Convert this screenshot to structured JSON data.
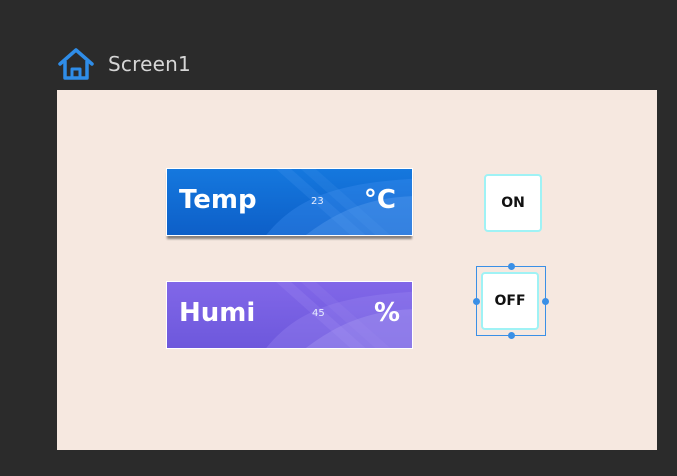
{
  "header": {
    "screen_name": "Screen1",
    "icon": "home-icon"
  },
  "colors": {
    "background": "#2b2b2b",
    "canvas": "#f6e8e0",
    "temp_widget": "#1570d8",
    "humi_widget": "#7962e4",
    "button_border": "#9ff2f5",
    "selection": "#3a8fe6"
  },
  "widgets": {
    "temp": {
      "label": "Temp",
      "value": "23",
      "unit": "°C"
    },
    "humi": {
      "label": "Humi",
      "value": "45",
      "unit": "%"
    }
  },
  "buttons": {
    "on_label": "ON",
    "off_label": "OFF"
  },
  "selection": {
    "selected_element": "off-button"
  }
}
